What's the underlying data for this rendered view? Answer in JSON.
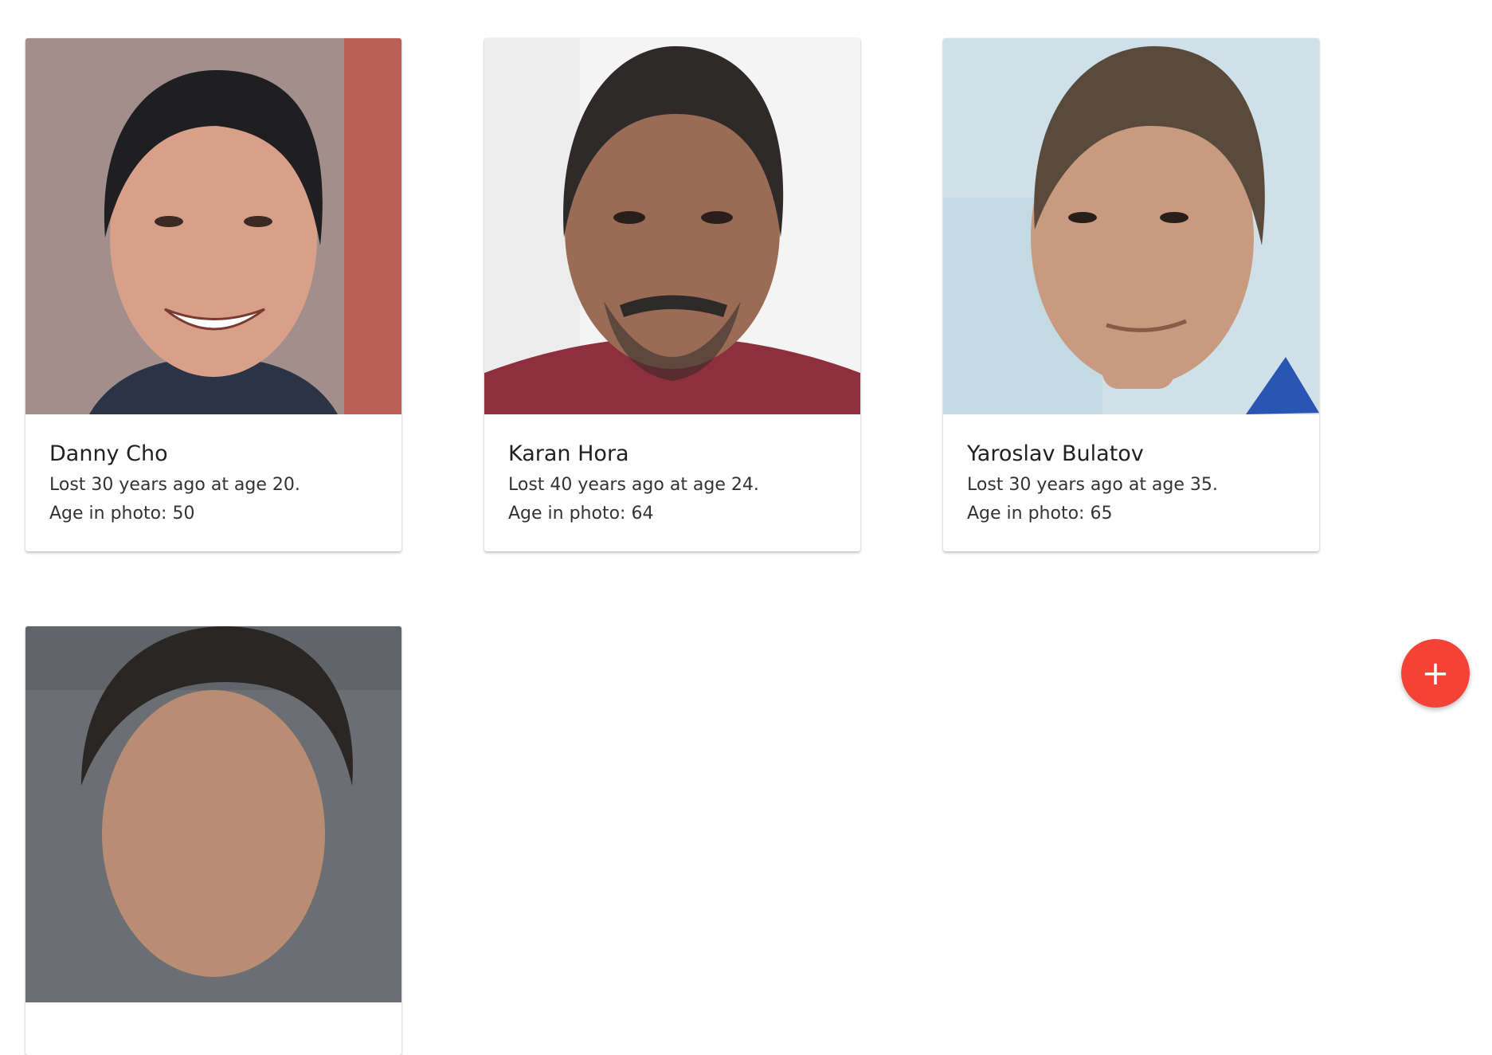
{
  "people": [
    {
      "name": "Danny Cho",
      "lost_text": "Lost 30 years ago at age 20.",
      "age_text": "Age in photo: 50",
      "photo_icon": "portrait-photo",
      "bg_color": "#a28f8c",
      "accent_color": "#c44a3a",
      "skin_color": "#d9a089",
      "hair_color": "#1f1f22",
      "shirt_color": "#2a3446"
    },
    {
      "name": "Karan Hora",
      "lost_text": "Lost 40 years ago at age 24.",
      "age_text": "Age in photo: 64",
      "photo_icon": "portrait-photo",
      "bg_color": "#f4f4f4",
      "accent_color": "#e8e8e8",
      "skin_color": "#9a6b55",
      "hair_color": "#2e2a2a",
      "shirt_color": "#8e2f3d"
    },
    {
      "name": "Yaroslav Bulatov",
      "lost_text": "Lost 30 years ago at age 35.",
      "age_text": "Age in photo: 65",
      "photo_icon": "portrait-photo",
      "bg_color": "#cfe0e8",
      "accent_color": "#bcd5df",
      "skin_color": "#c89a80",
      "hair_color": "#5a4a3c",
      "shirt_color": "#2a55b5"
    },
    {
      "name": "",
      "lost_text": "",
      "age_text": "",
      "photo_icon": "portrait-photo",
      "bg_color": "#6b6f74",
      "accent_color": "#5a5e63",
      "skin_color": "#b98c74",
      "hair_color": "#2a2624",
      "shirt_color": "#3a3a3a"
    }
  ],
  "fab": {
    "label": "+",
    "color": "#f44336",
    "icon": "plus-icon"
  }
}
